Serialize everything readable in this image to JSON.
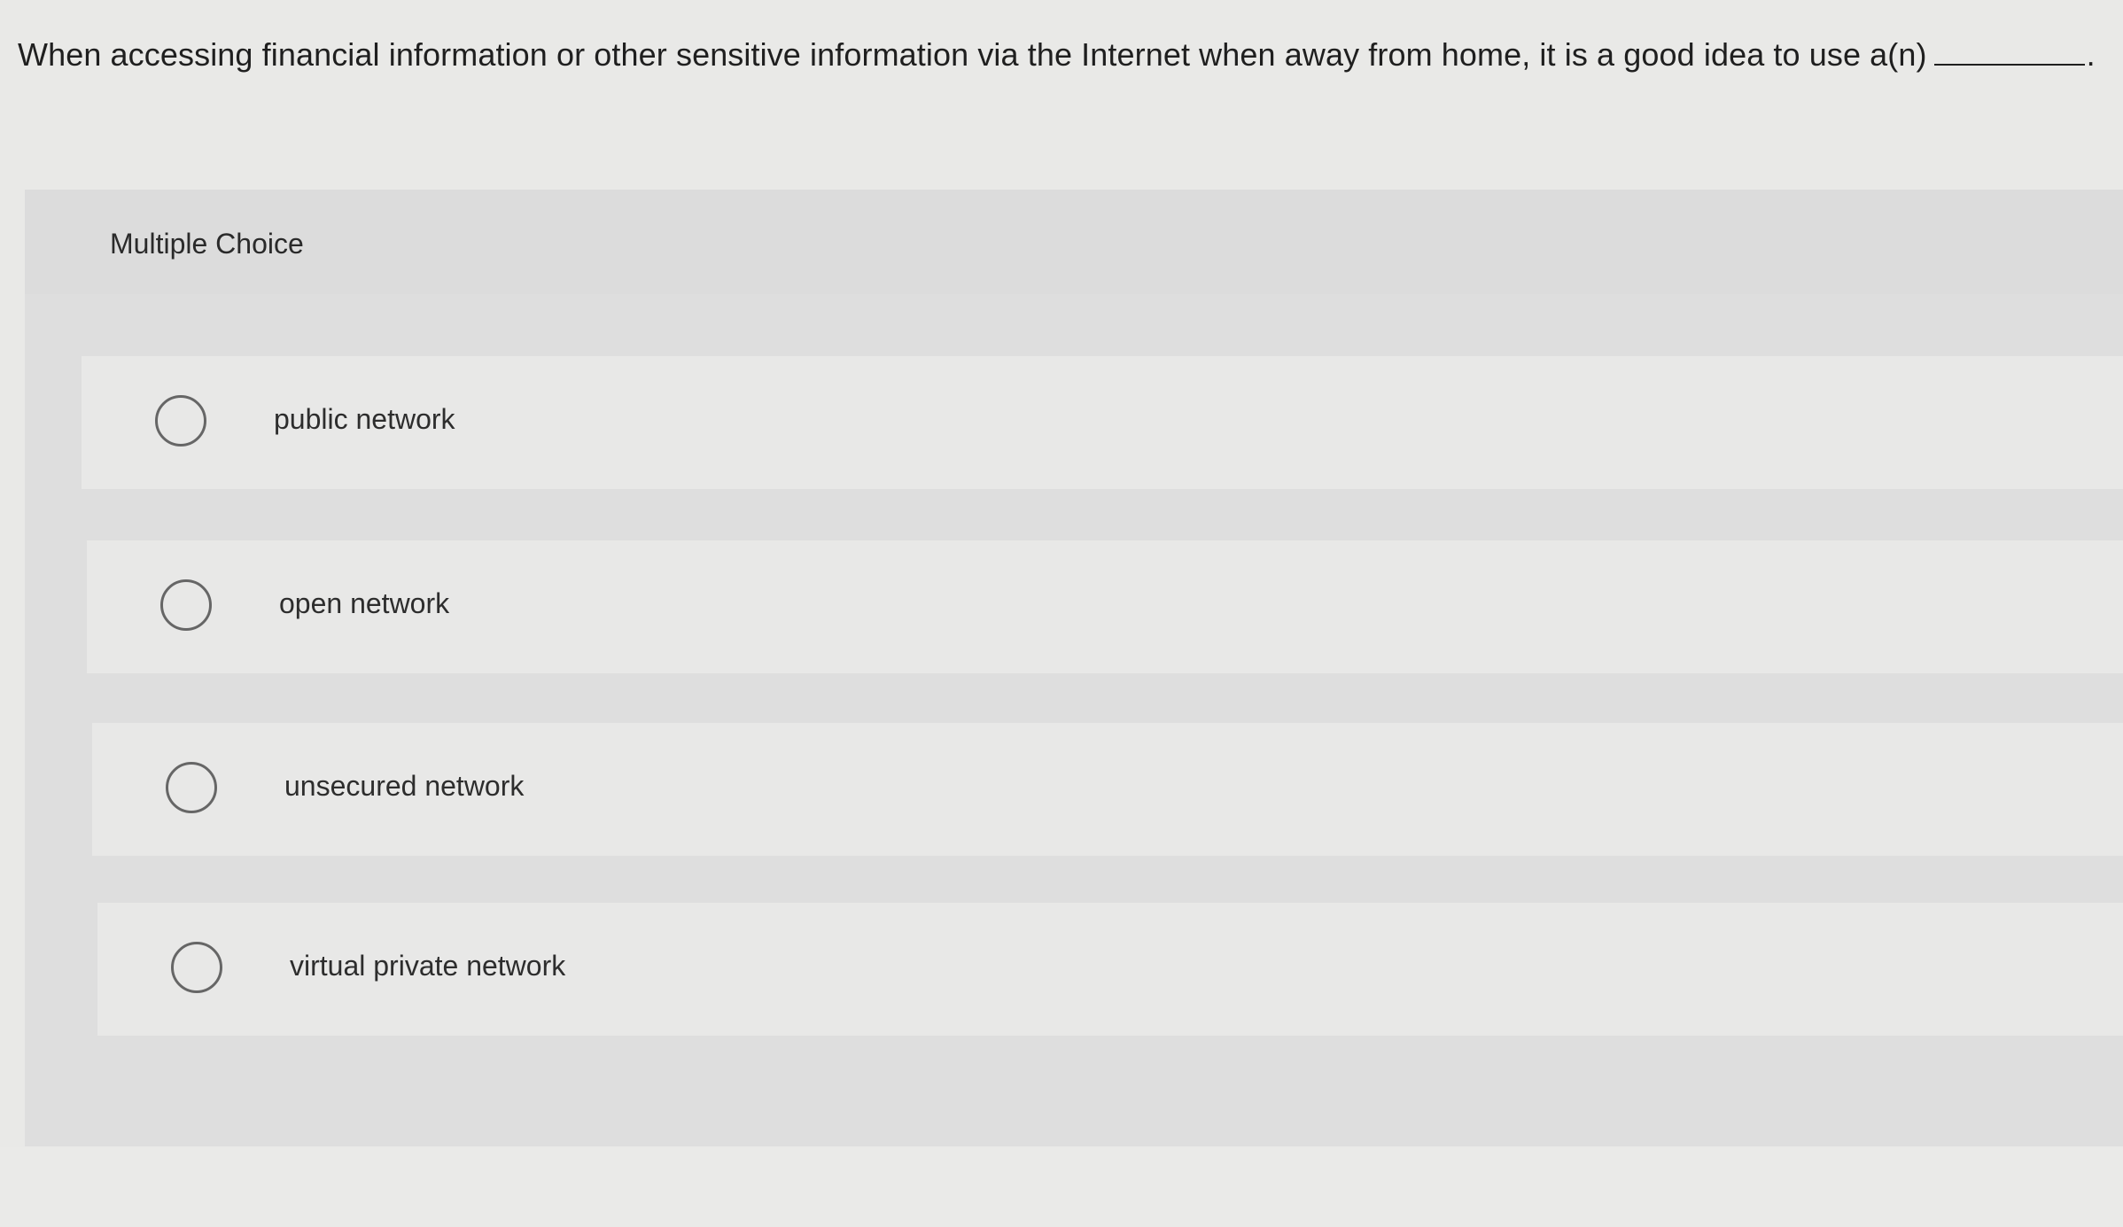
{
  "question": {
    "text": "When accessing financial information or other sensitive information via the Internet when away from home, it is a good idea to use a(n)",
    "ending": "."
  },
  "panel": {
    "title": "Multiple Choice"
  },
  "options": [
    {
      "label": "public network"
    },
    {
      "label": "open network"
    },
    {
      "label": "unsecured network"
    },
    {
      "label": "virtual private network"
    }
  ],
  "colors": {
    "background": "#e9e9e7",
    "panel": "#dedede",
    "option": "#e8e8e7",
    "text": "#1f1f1f",
    "radio_border": "#666666"
  },
  "icons": {
    "radio": "empty-radio-circle"
  }
}
